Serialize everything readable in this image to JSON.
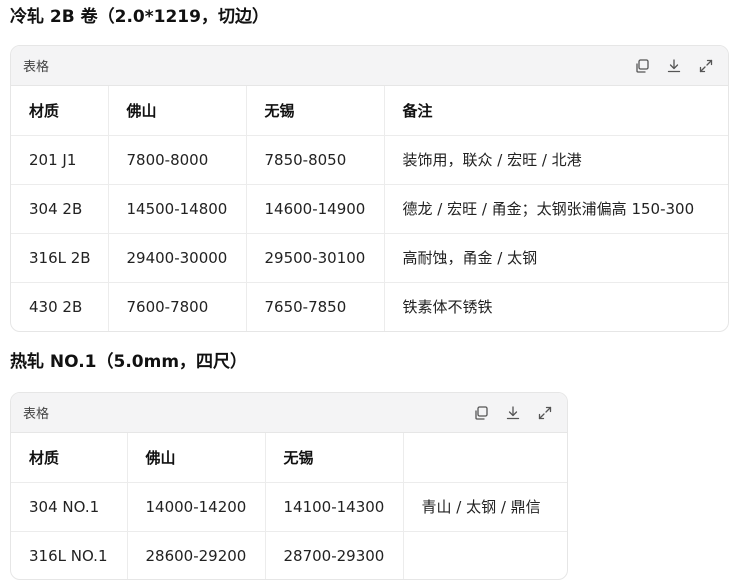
{
  "section1": {
    "title": "冷轧 2B 卷（2.0*1219，切边）",
    "table_label": "表格",
    "headers": [
      "材质",
      "佛山",
      "无锡",
      "备注"
    ],
    "rows": [
      [
        "201 J1",
        "7800-8000",
        "7850-8050",
        "装饰用，联众 / 宏旺 / 北港"
      ],
      [
        "304 2B",
        "14500-14800",
        "14600-14900",
        "德龙 / 宏旺 / 甬金；太钢张浦偏高 150-300"
      ],
      [
        "316L 2B",
        "29400-30000",
        "29500-30100",
        "高耐蚀，甬金 / 太钢"
      ],
      [
        "430 2B",
        "7600-7800",
        "7650-7850",
        "铁素体不锈铁"
      ]
    ]
  },
  "section2": {
    "title": "热轧 NO.1（5.0mm，四尺）",
    "table_label": "表格",
    "headers": [
      "材质",
      "佛山",
      "无锡",
      ""
    ],
    "rows": [
      [
        "304 NO.1",
        "14000-14200",
        "14100-14300",
        "青山 / 太钢 / 鼎信"
      ],
      [
        "316L NO.1",
        "28600-29200",
        "28700-29300",
        ""
      ]
    ]
  },
  "icons": {
    "copy": "copy-icon",
    "download": "download-icon",
    "expand": "expand-icon"
  }
}
